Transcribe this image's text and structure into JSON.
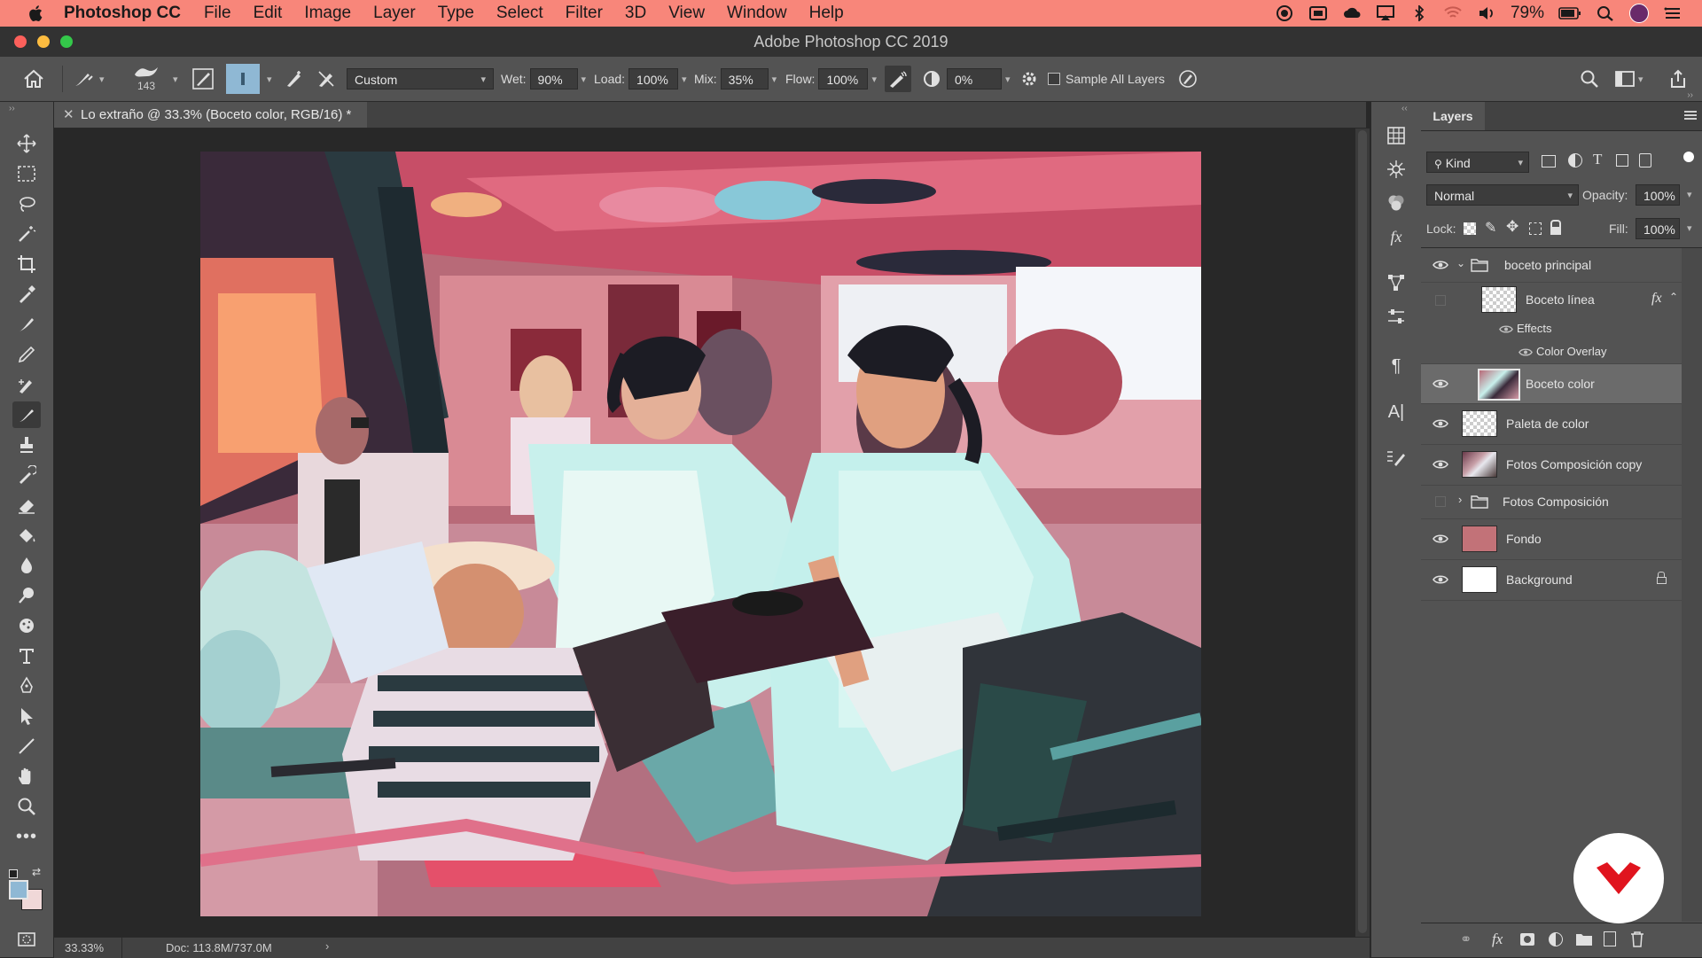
{
  "menubar": {
    "app_name": "Photoshop CC",
    "items": [
      "File",
      "Edit",
      "Image",
      "Layer",
      "Type",
      "Select",
      "Filter",
      "3D",
      "View",
      "Window",
      "Help"
    ],
    "battery": "79%",
    "bg_color": "#f8867a"
  },
  "window": {
    "title": "Adobe Photoshop CC 2019"
  },
  "options": {
    "brush_size": "143",
    "preset": "Custom",
    "wet_label": "Wet:",
    "wet_value": "90%",
    "load_label": "Load:",
    "load_value": "100%",
    "mix_label": "Mix:",
    "mix_value": "35%",
    "flow_label": "Flow:",
    "flow_value": "100%",
    "smoothing_value": "0%",
    "sample_all_layers": "Sample All Layers"
  },
  "document": {
    "tab_title": "Lo extraño @ 33.3% (Boceto color, RGB/16) *",
    "zoom": "33.33%",
    "doc_size": "Doc: 113.8M/737.0M"
  },
  "layers_panel": {
    "title": "Layers",
    "filter_kind": "Kind",
    "blend_mode": "Normal",
    "opacity_label": "Opacity:",
    "opacity_value": "100%",
    "lock_label": "Lock:",
    "fill_label": "Fill:",
    "fill_value": "100%",
    "layers": [
      {
        "name": "boceto principal",
        "type": "group",
        "visible": true,
        "expanded": true
      },
      {
        "name": "Boceto línea",
        "type": "layer",
        "visible": false,
        "fx": "fx"
      },
      {
        "name": "Effects",
        "type": "effects"
      },
      {
        "name": "Color Overlay",
        "type": "effect"
      },
      {
        "name": "Boceto color",
        "type": "layer",
        "visible": true,
        "selected": true
      },
      {
        "name": "Paleta de color",
        "type": "layer",
        "visible": true
      },
      {
        "name": "Fotos Composición copy",
        "type": "layer",
        "visible": true
      },
      {
        "name": "Fotos Composición",
        "type": "group",
        "visible": false,
        "expanded": false
      },
      {
        "name": "Fondo",
        "type": "layer",
        "visible": true,
        "thumb_color": "#c27278"
      },
      {
        "name": "Background",
        "type": "layer",
        "visible": true,
        "locked": true
      }
    ]
  },
  "colors": {
    "foreground": "#8fb8d4",
    "background": "#f0d8d8",
    "accent_logo": "#e0141e"
  }
}
